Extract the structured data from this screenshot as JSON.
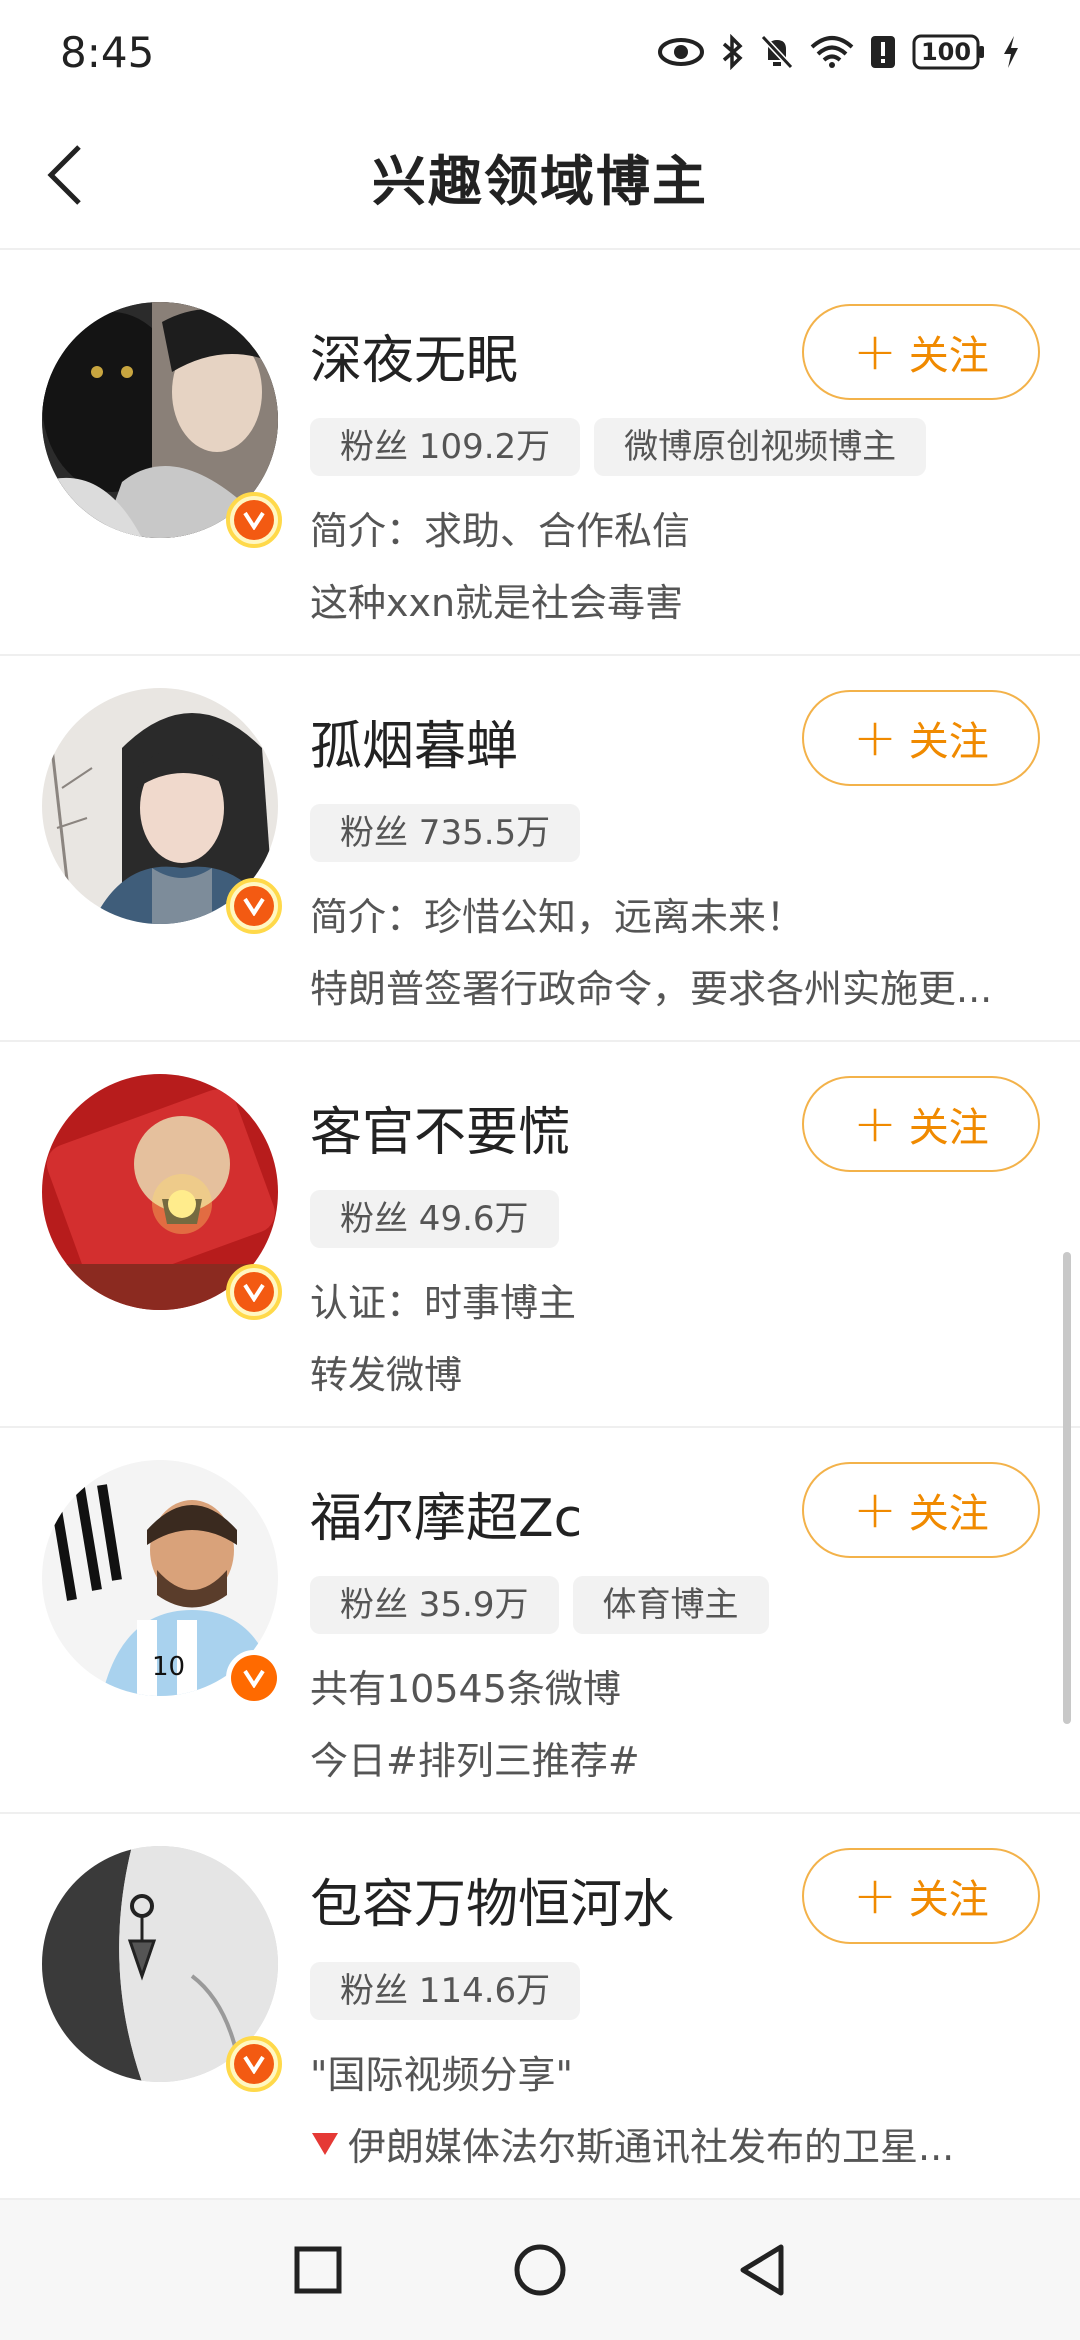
{
  "status_bar": {
    "time": "8:45",
    "battery": "100",
    "icons": [
      "eye-icon",
      "bluetooth-icon",
      "mute-icon",
      "wifi-icon",
      "alert-icon",
      "battery-icon",
      "charging-icon"
    ]
  },
  "header": {
    "title": "兴趣领域博主",
    "back_icon": "chevron-left-icon"
  },
  "follow_label": "关注",
  "accent_color": "#f08a00",
  "users": [
    {
      "name": "深夜无眠",
      "tags": [
        "粉丝 109.2万",
        "微博原创视频博主"
      ],
      "line1": "简介：求助、合作私信",
      "line2": "这种xxn就是社会毒害",
      "badge": "verified-v-icon"
    },
    {
      "name": "孤烟暮蝉",
      "tags": [
        "粉丝 735.5万"
      ],
      "line1": "简介：珍惜公知，远离未来！",
      "line2": "特朗普签署行政命令，要求各州实施更...",
      "badge": "verified-v-icon"
    },
    {
      "name": "客官不要慌",
      "tags": [
        "粉丝 49.6万"
      ],
      "line1": "认证：时事博主",
      "line2": "转发微博",
      "badge": "verified-v-icon"
    },
    {
      "name": "福尔摩超Zc",
      "tags": [
        "粉丝 35.9万",
        "体育博主"
      ],
      "line1": "共有10545条微博",
      "line2": "今日#排列三推荐#",
      "badge": "verified-v-icon"
    },
    {
      "name": "包容万物恒河水",
      "tags": [
        "粉丝 114.6万"
      ],
      "line1": "\"国际视频分享\"",
      "line2": "伊朗媒体法尔斯通讯社发布的卫星...",
      "badge": "verified-v-icon"
    }
  ],
  "nav_bar": {
    "icons": [
      "recent-apps-icon",
      "home-icon",
      "back-icon"
    ]
  }
}
